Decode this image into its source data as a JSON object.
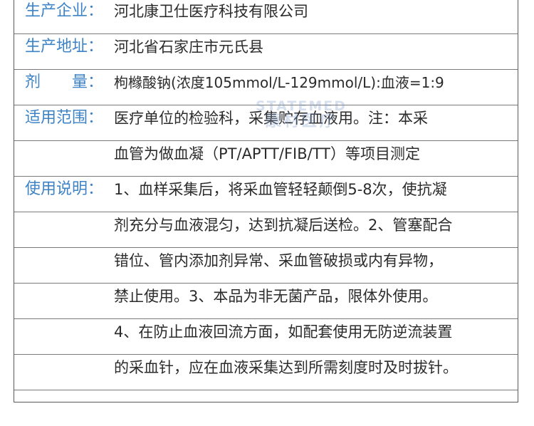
{
  "rows": [
    {
      "label": "生产企业：",
      "value": "河北康卫仕医疗科技有限公司"
    },
    {
      "label": "生产地址：",
      "value": "河北省石家庄市元氏县"
    },
    {
      "label_chars": [
        "剂",
        "量："
      ],
      "value": "枸橼酸钠(浓度105mmol/L-129mmol/L):血液=1:9"
    },
    {
      "label": "适用范围：",
      "value": "医疗单位的检验科，采集贮存血液用。注：本采"
    },
    {
      "label": "",
      "value": "血管为做血凝（PT/APTT/FIB/TT）等项目测定"
    },
    {
      "label": "使用说明：",
      "value": "1、血样采集后，将采血管轻轻颠倒5-8次，使抗凝"
    },
    {
      "label": "",
      "value": "剂充分与血液混匀，达到抗凝后送检。2、管塞配合"
    },
    {
      "label": "",
      "value": "错位、管内添加剂异常、采血管破损或内有异物，"
    },
    {
      "label": "",
      "value": "禁止使用。3、本品为非无菌产品，限体外使用。"
    },
    {
      "label": "",
      "value": "4、在防止血液回流方面，如配套使用无防逆流装置"
    },
    {
      "label": "",
      "value": "的采血针，应在血液采集达到所需刻度时及时拔针。"
    },
    {
      "label": "",
      "value": ""
    }
  ],
  "watermark": {
    "line1": "STATEMED",
    "line2": "康材医疗"
  },
  "colors": {
    "label": "#3d83c6",
    "text": "#2b2b2b",
    "border": "#7a7a7a"
  }
}
